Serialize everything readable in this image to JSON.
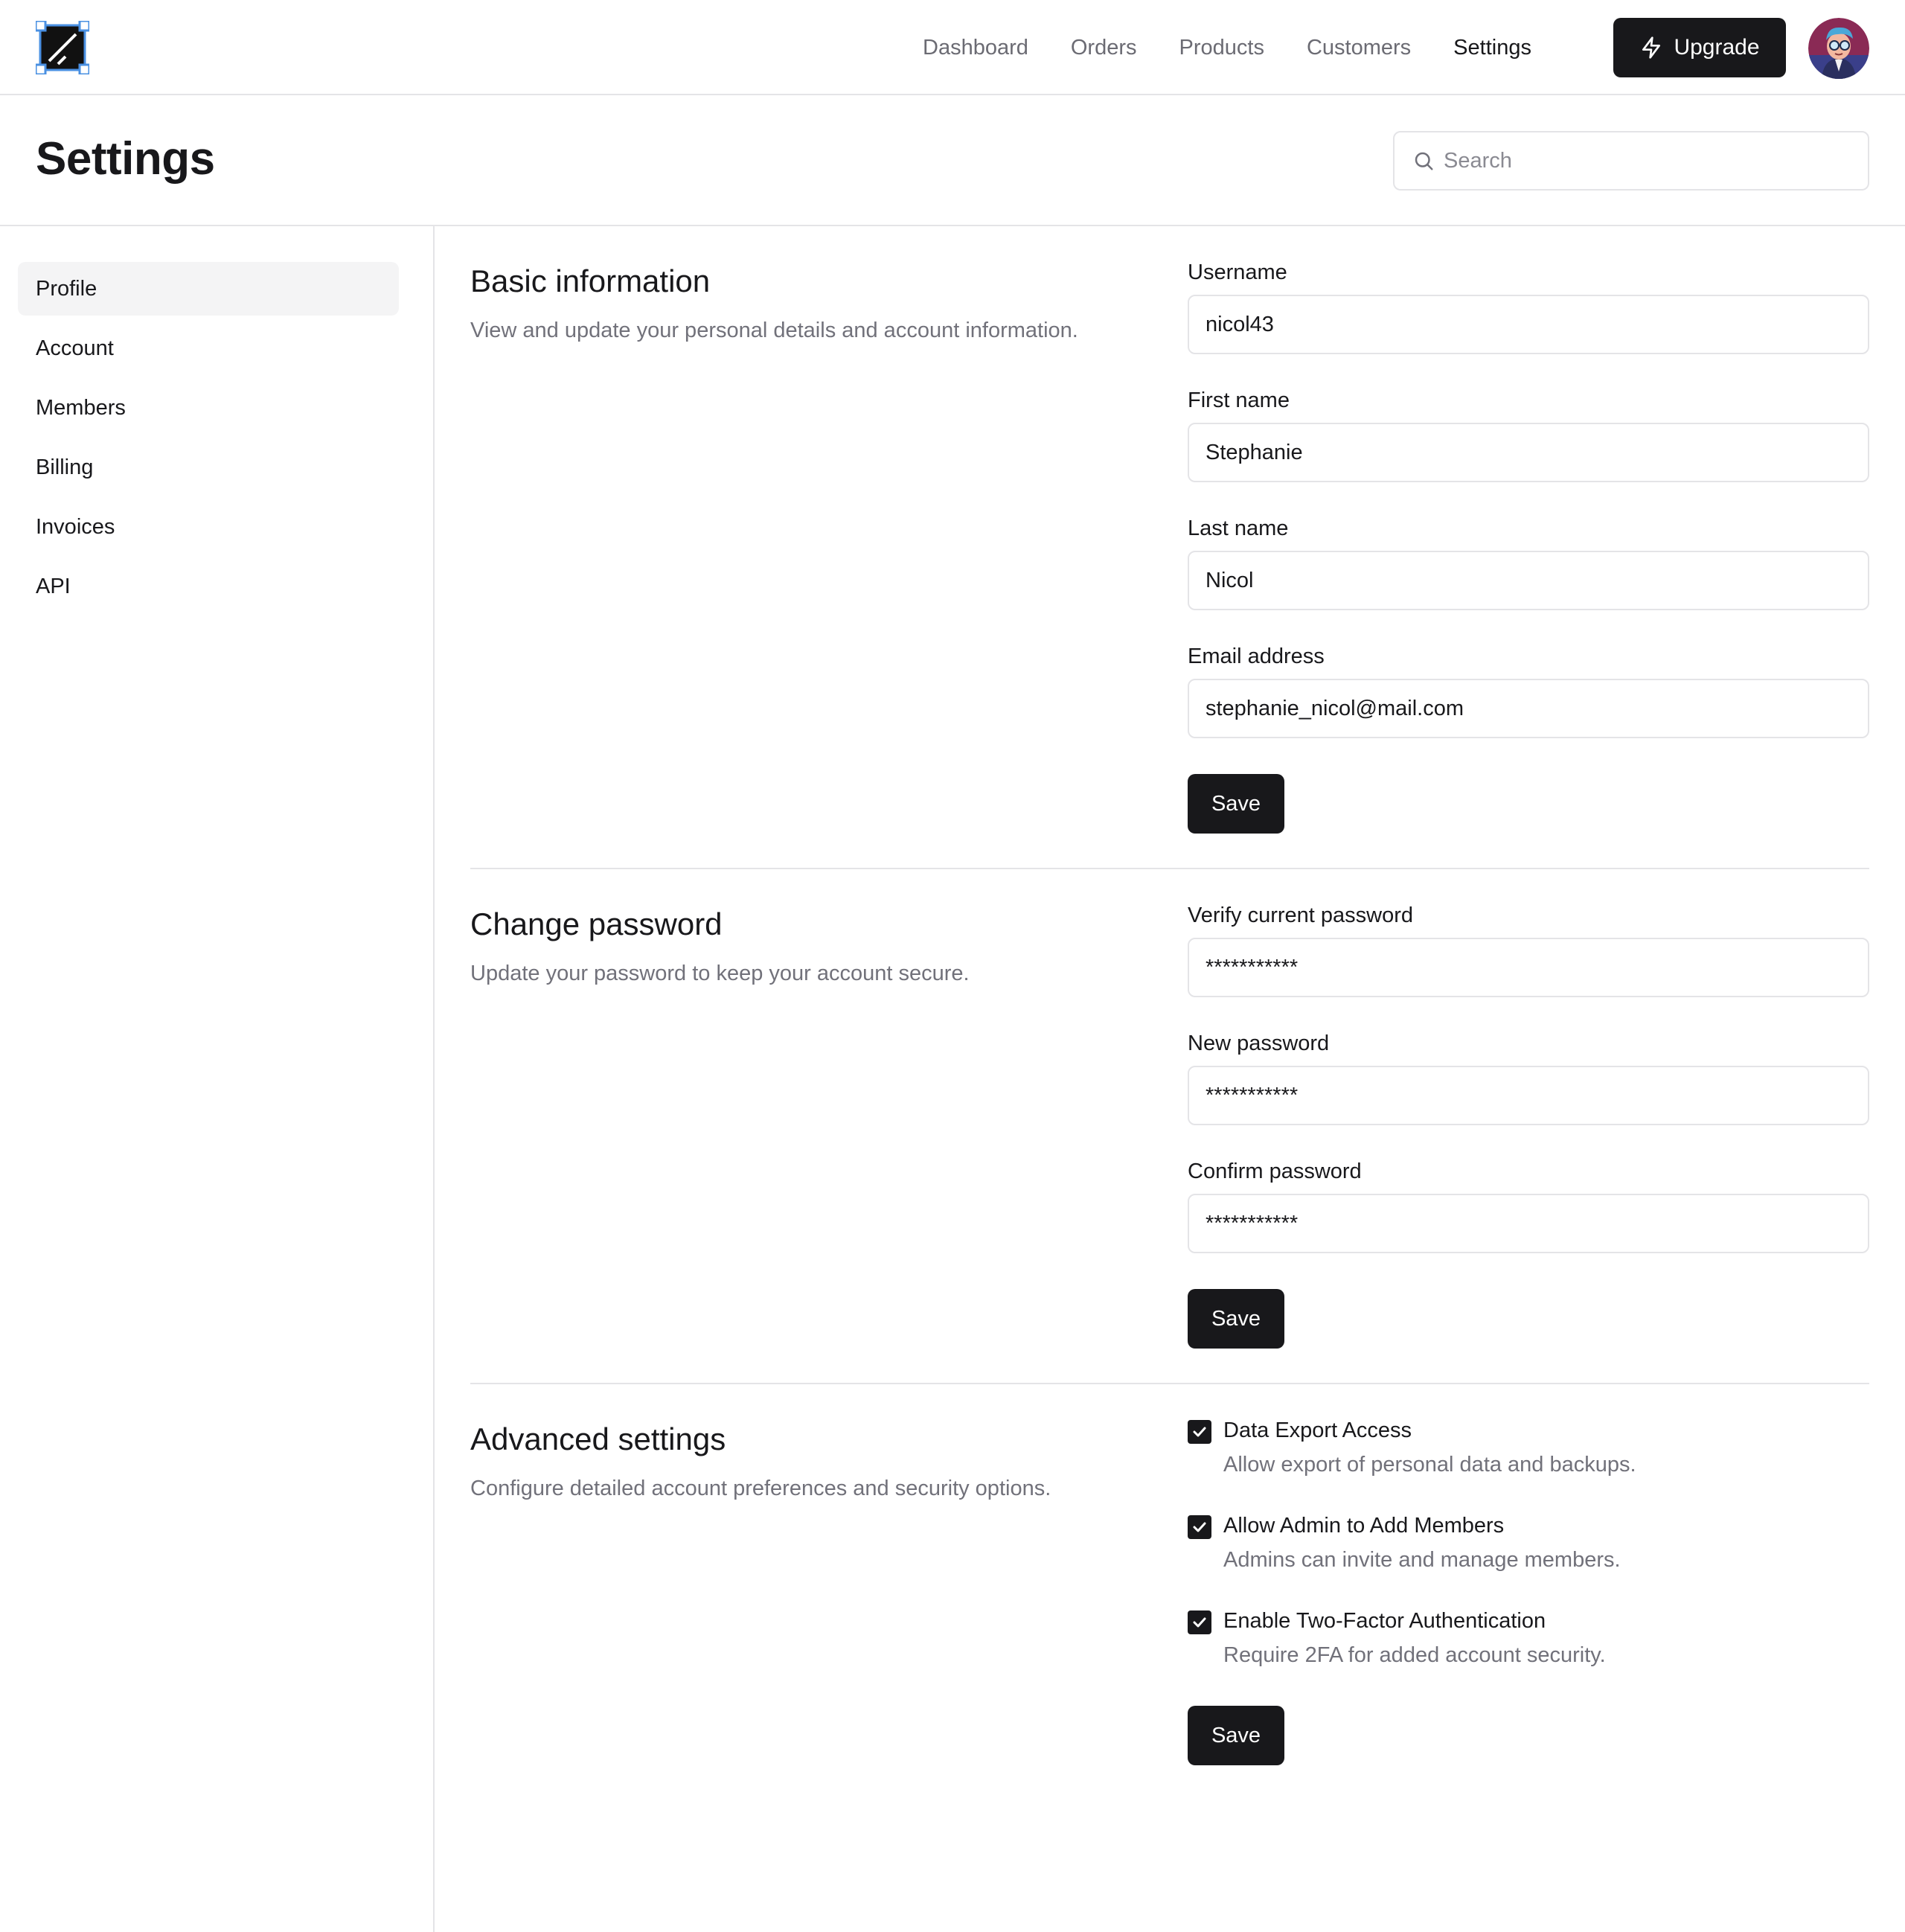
{
  "nav": {
    "links": [
      {
        "label": "Dashboard",
        "active": false
      },
      {
        "label": "Orders",
        "active": false
      },
      {
        "label": "Products",
        "active": false
      },
      {
        "label": "Customers",
        "active": false
      },
      {
        "label": "Settings",
        "active": true
      }
    ],
    "upgrade_label": "Upgrade"
  },
  "header": {
    "title": "Settings",
    "search_placeholder": "Search"
  },
  "sidebar": {
    "items": [
      {
        "label": "Profile",
        "active": true
      },
      {
        "label": "Account",
        "active": false
      },
      {
        "label": "Members",
        "active": false
      },
      {
        "label": "Billing",
        "active": false
      },
      {
        "label": "Invoices",
        "active": false
      },
      {
        "label": "API",
        "active": false
      }
    ]
  },
  "basic_info": {
    "title": "Basic information",
    "description": "View and update your personal details and account information.",
    "username_label": "Username",
    "username_value": "nicol43",
    "first_name_label": "First name",
    "first_name_value": "Stephanie",
    "last_name_label": "Last name",
    "last_name_value": "Nicol",
    "email_label": "Email address",
    "email_value": "stephanie_nicol@mail.com",
    "save_label": "Save"
  },
  "password": {
    "title": "Change password",
    "description": "Update your password to keep your account secure.",
    "current_label": "Verify current password",
    "current_value": "***********",
    "new_label": "New password",
    "new_value": "***********",
    "confirm_label": "Confirm password",
    "confirm_value": "***********",
    "save_label": "Save"
  },
  "advanced": {
    "title": "Advanced settings",
    "description": "Configure detailed account preferences and security options.",
    "options": [
      {
        "label": "Data Export Access",
        "description": "Allow export of personal data and backups.",
        "checked": true
      },
      {
        "label": "Allow Admin to Add Members",
        "description": "Admins can invite and manage members.",
        "checked": true
      },
      {
        "label": "Enable Two-Factor Authentication",
        "description": "Require 2FA for added account security.",
        "checked": true
      }
    ],
    "save_label": "Save"
  },
  "colors": {
    "primary": "#18181b",
    "border": "#e4e4e7",
    "muted_text": "#71717a",
    "active_bg": "#f4f4f5",
    "logo_accent": "#4a90e2"
  }
}
